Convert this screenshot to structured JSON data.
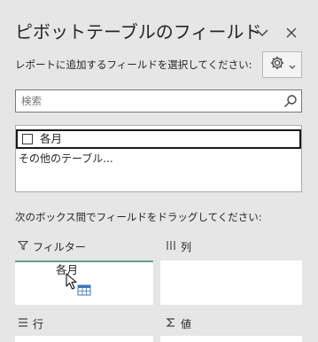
{
  "header": {
    "title": "ピボットテーブルのフィールド"
  },
  "subtitle": "レポートに追加するフィールドを選択してください:",
  "search": {
    "placeholder": "検索"
  },
  "fields": {
    "items": [
      {
        "label": "各月",
        "checked": false
      }
    ],
    "other_tables": "その他のテーブル..."
  },
  "drag_hint": "次のボックス間でフィールドをドラッグしてください:",
  "areas": {
    "filter": {
      "label": "フィルター",
      "icon": "filter-icon"
    },
    "columns": {
      "label": "列",
      "icon": "columns-icon"
    },
    "rows": {
      "label": "行",
      "icon": "rows-icon"
    },
    "values": {
      "label": "値",
      "icon": "sigma-icon"
    }
  },
  "dragging": {
    "label": "各月"
  },
  "colors": {
    "panel_bg": "#e6e6e6",
    "filter_accent": "#5fa58d",
    "drag_icon": "#3c78b4"
  }
}
